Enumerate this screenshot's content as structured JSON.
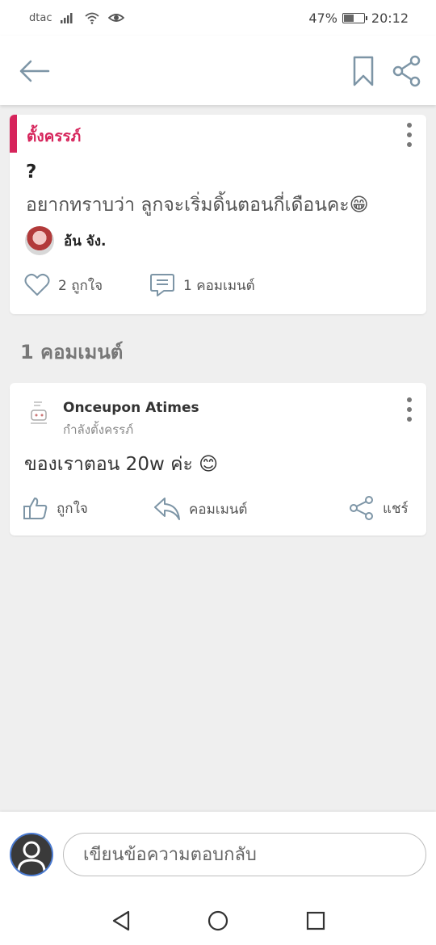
{
  "status_bar": {
    "carrier": "dtac",
    "battery_percent": "47%",
    "battery_level": 0.47,
    "time": "20:12"
  },
  "post": {
    "category": "ตั้งครรภ์",
    "title": "?",
    "body": "อยากทราบว่า ลูกจะเริ่มดิ้นตอนกี่เดือนคะ😁",
    "author": "อ้น จัง.",
    "likes_label": "2 ถูกใจ",
    "comments_label": "1 คอมเมนต์"
  },
  "comments_section": {
    "title": "1 คอมเมนต์"
  },
  "comment": {
    "author": "Onceupon Atimes",
    "status": "กำลังตั้งครรภ์",
    "text": "ของเราตอน 20w ค่ะ 😊",
    "like_label": "ถูกใจ",
    "reply_label": "คอมเมนต์",
    "share_label": "แชร์"
  },
  "reply_box": {
    "placeholder": "เขียนข้อความตอบกลับ"
  },
  "colors": {
    "accent": "#d6245b",
    "icon": "#7d95a6",
    "background": "#efefef"
  },
  "icons": [
    "back-arrow-icon",
    "bookmark-icon",
    "share-icon",
    "more-vertical-icon",
    "heart-icon",
    "comment-icon",
    "thumbs-up-icon",
    "reply-icon",
    "user-icon",
    "nav-back-icon",
    "nav-home-icon",
    "nav-recent-icon"
  ]
}
